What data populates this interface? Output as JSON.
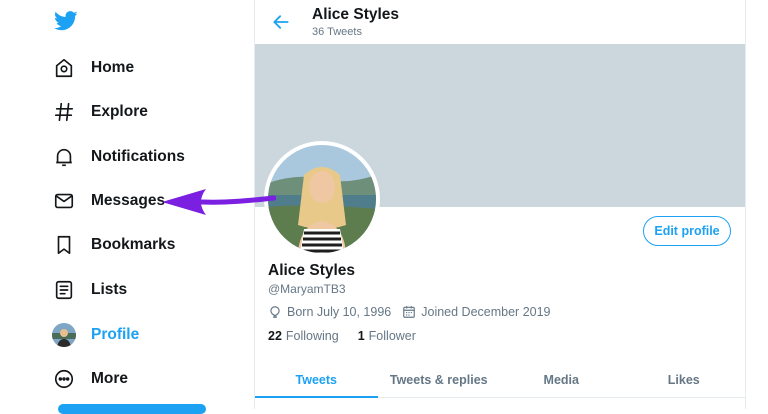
{
  "colors": {
    "accent": "#1da1f2",
    "banner": "#ccd6dd",
    "arrow": "#7b1fe0"
  },
  "sidebar": {
    "logo_icon": "twitter-bird-icon",
    "items": [
      {
        "label": "Home",
        "icon": "home-icon"
      },
      {
        "label": "Explore",
        "icon": "hashtag-icon"
      },
      {
        "label": "Notifications",
        "icon": "bell-icon"
      },
      {
        "label": "Messages",
        "icon": "envelope-icon"
      },
      {
        "label": "Bookmarks",
        "icon": "bookmark-icon"
      },
      {
        "label": "Lists",
        "icon": "list-icon"
      },
      {
        "label": "Profile",
        "icon": "avatar",
        "active": true
      },
      {
        "label": "More",
        "icon": "more-circle-icon"
      }
    ]
  },
  "header": {
    "title": "Alice Styles",
    "subtitle": "36 Tweets"
  },
  "profile": {
    "name": "Alice Styles",
    "handle": "@MaryamTB3",
    "born": "Born July 10, 1996",
    "joined": "Joined December 2019",
    "following_count": "22",
    "following_label": "Following",
    "followers_count": "1",
    "followers_label": "Follower",
    "edit_label": "Edit profile"
  },
  "tabs": [
    {
      "label": "Tweets",
      "active": true
    },
    {
      "label": "Tweets & replies"
    },
    {
      "label": "Media"
    },
    {
      "label": "Likes"
    }
  ]
}
